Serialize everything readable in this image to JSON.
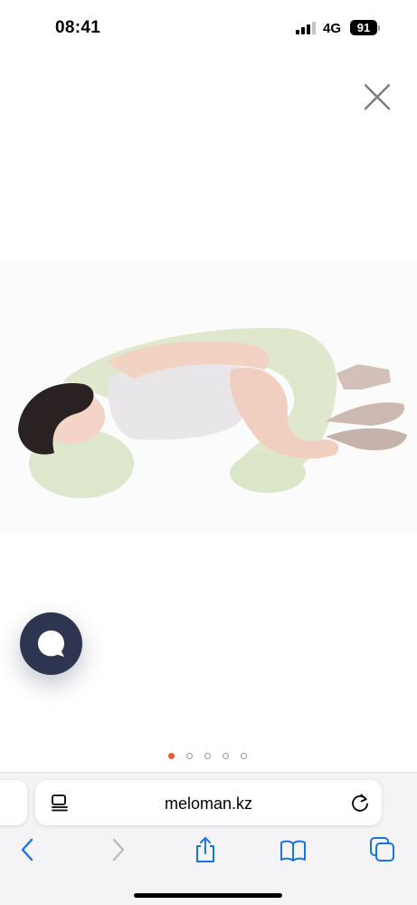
{
  "status_bar": {
    "time": "08:41",
    "network": "4G",
    "battery": "91",
    "icons": [
      "cellular-signal-icon",
      "battery-icon"
    ]
  },
  "product_gallery": {
    "image_alt": "woman sleeping on pregnancy pillow",
    "pillow_color": "#dfe8cd",
    "slide_count": 5,
    "active_slide": 1,
    "accent_color": "#f05a28"
  },
  "chat_widget": {
    "icon": "chat-bubble-icon",
    "color": "#2e3551"
  },
  "browser": {
    "url": "meloman.kz",
    "icons": [
      "reader-icon",
      "reload-icon",
      "back-icon",
      "forward-icon",
      "share-icon",
      "bookmarks-icon",
      "tabs-icon"
    ],
    "tint_color": "#1a73e8"
  }
}
